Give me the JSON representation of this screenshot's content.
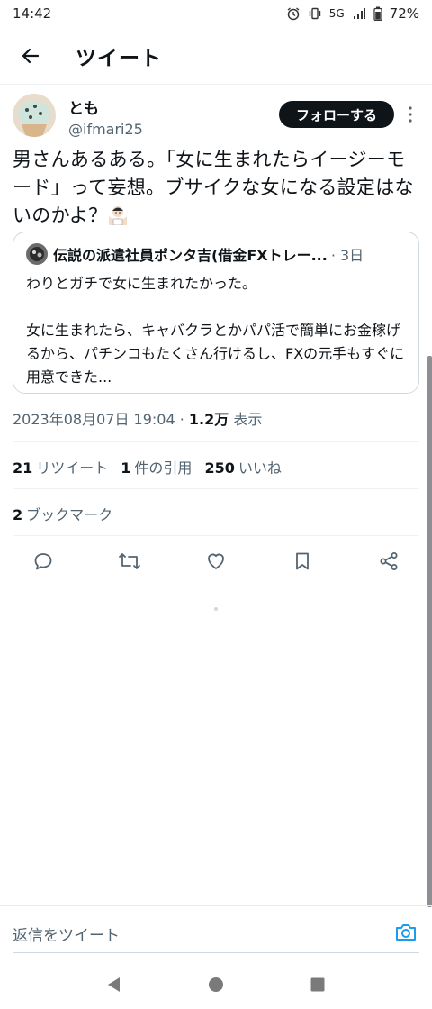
{
  "status_bar": {
    "time": "14:42",
    "network": "5G",
    "battery": "72%"
  },
  "header": {
    "title": "ツイート"
  },
  "tweet": {
    "author": {
      "display_name": "とも",
      "handle": "@ifmari25"
    },
    "follow_label": "フォローする",
    "text": "男さんあるある。「女に生まれたらイージーモード」って妄想。ブサイクな女になる設定はないのかよ？",
    "emoji": "person-shrugging",
    "quote": {
      "author": "伝説の派遣社員ポンタ吉(借金FXトレー...",
      "time": "· 3日",
      "body": "わりとガチで女に生まれたかった。\n\n女に生まれたら、キャバクラとかパパ活で簡単にお金稼げるから、パチンコもたくさん行けるし、FXの元手もすぐに用意できた..."
    },
    "timestamp": "2023年08月07日 19:04 · ",
    "views_count": "1.2万",
    "views_label": " 表示",
    "stats": {
      "retweets_count": "21",
      "retweets_label": "リツイート",
      "quotes_count": "1",
      "quotes_label": "件の引用",
      "likes_count": "250",
      "likes_label": "いいね",
      "bookmarks_count": "2",
      "bookmarks_label": "ブックマーク"
    }
  },
  "reply": {
    "placeholder": "返信をツイート"
  },
  "colors": {
    "text": "#0f1419",
    "muted": "#536471",
    "accent": "#1d9bf0",
    "border": "#cfd9de"
  },
  "icons": [
    "alarm-icon",
    "vibrate-icon",
    "signal-icon",
    "battery-icon",
    "back-arrow-icon",
    "more-vert-icon",
    "reply-icon",
    "retweet-icon",
    "like-icon",
    "bookmark-icon",
    "share-icon",
    "camera-icon",
    "nav-back-icon",
    "nav-home-icon",
    "nav-recents-icon"
  ]
}
